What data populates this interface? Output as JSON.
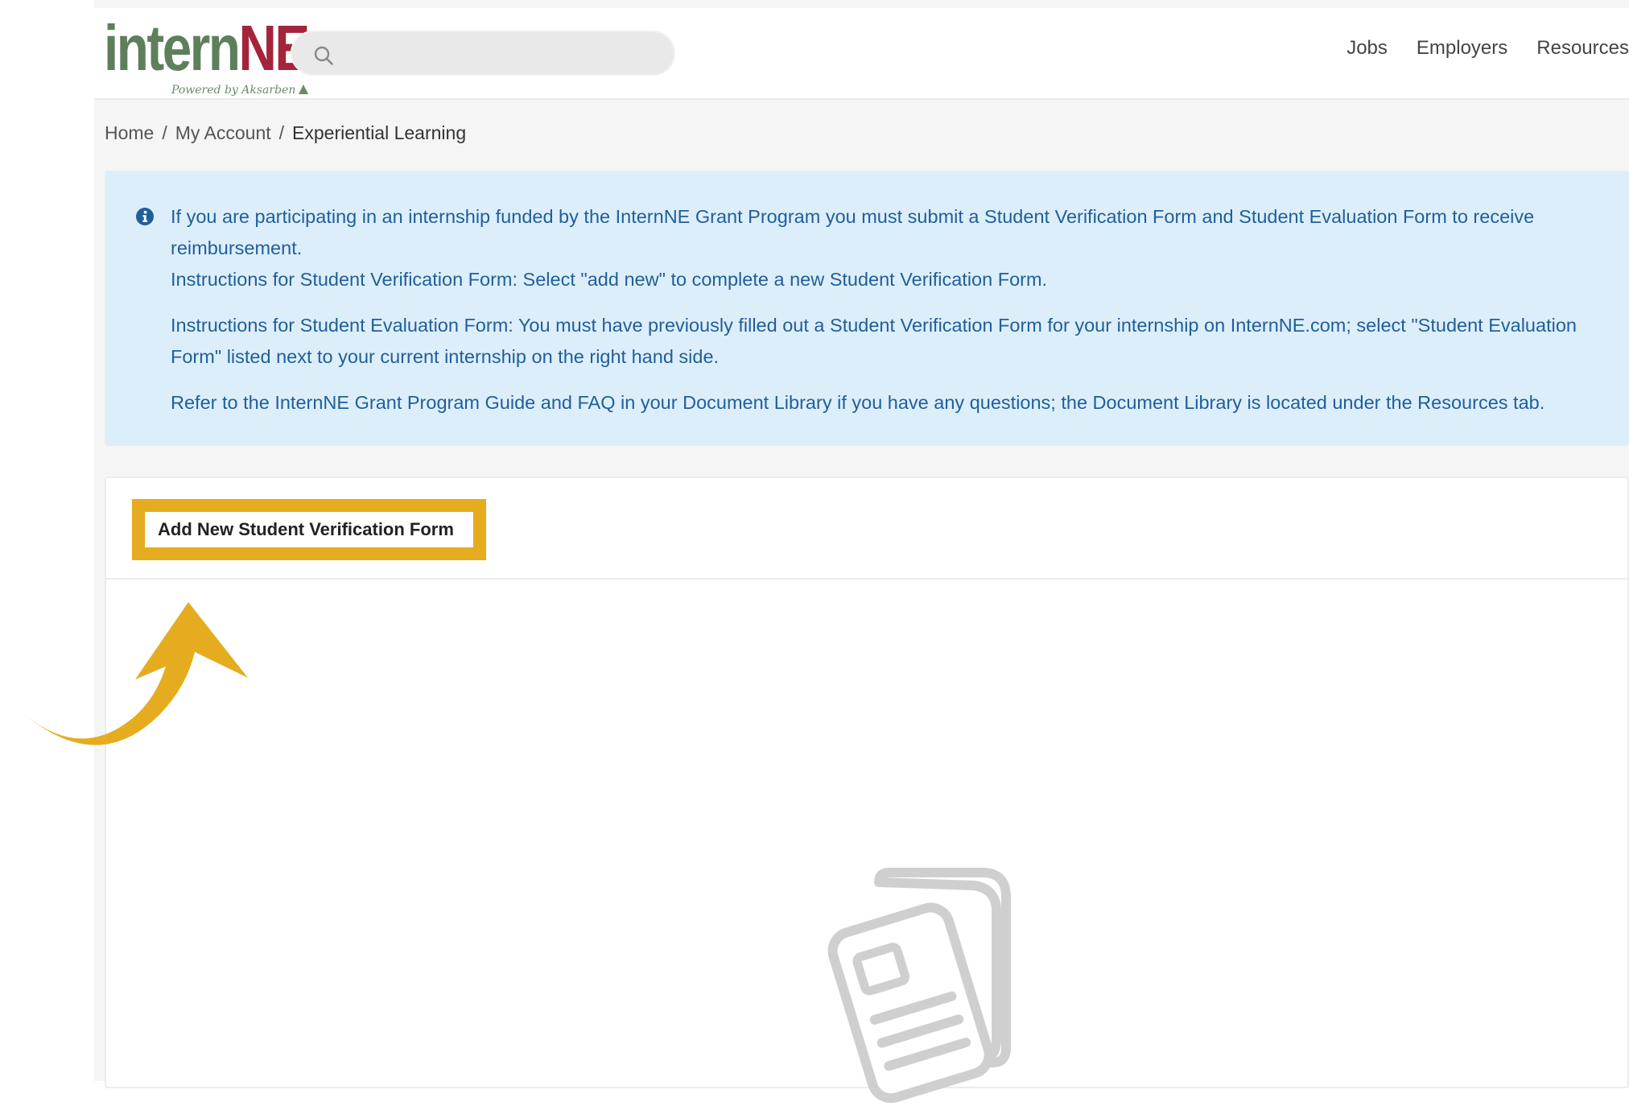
{
  "header": {
    "logo": {
      "intern": "intern",
      "ne": "NE",
      "tagline": "Powered by Aksarben"
    },
    "search": {
      "placeholder": "",
      "icon": "search-icon"
    },
    "nav": [
      {
        "label": "Jobs"
      },
      {
        "label": "Employers"
      },
      {
        "label": "Resources"
      }
    ]
  },
  "breadcrumb": {
    "items": [
      "Home",
      "My Account"
    ],
    "separator": "/",
    "current": "Experiential Learning"
  },
  "alert": {
    "icon": "info-icon",
    "lines": [
      "If you are participating in an internship funded by the InternNE Grant Program you must submit a Student Verification Form and Student Evaluation Form to receive reimbursement.",
      "Instructions for Student Verification Form: Select \"add new\" to complete a new Student Verification Form.",
      "Instructions for Student Evaluation Form: You must have previously filled out a Student Verification Form for your internship on InternNE.com; select \"Student Evaluation Form\" listed next to your current internship on the right hand side.",
      "Refer to the InternNE Grant Program Guide and FAQ in your Document Library if you have any questions; the Document Library is located under the Resources tab."
    ],
    "color": "#1f5f9a",
    "background": "#ddeefb"
  },
  "card": {
    "add_button_label": "Add New Student Verification Form",
    "highlight_color": "#e6ac1f",
    "empty_state_icon": "documents-icon"
  },
  "annotation": {
    "icon": "curved-arrow-icon",
    "color": "#e6ac1f"
  }
}
